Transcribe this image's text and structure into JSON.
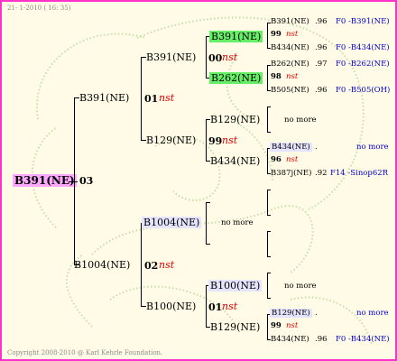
{
  "header": {
    "date": "21- 1-2010 ( 16: 35)"
  },
  "footer": {
    "copyright": "Copyright 2008-2010 @ Karl Kehrle Foundation."
  },
  "root": {
    "name": "B391(NE)",
    "code": "03"
  },
  "gen1": [
    {
      "name": "B391(NE)",
      "code": "01",
      "nst": "nst"
    },
    {
      "name": "B1004(NE)",
      "code": "02",
      "nst": "nst"
    }
  ],
  "gen2": [
    {
      "name": "B391(NE)",
      "code": "00",
      "nst": "nst"
    },
    {
      "name": "B129(NE)",
      "code": "99",
      "nst": "nst"
    },
    {
      "name": "B1004(NE)",
      "nomore": "no more"
    },
    {
      "name": "B100(NE)",
      "code": "01",
      "nst": "nst"
    }
  ],
  "gen3": [
    {
      "name": "B391(NE)"
    },
    {
      "name": "B262(NE)"
    },
    {
      "name": "B129(NE)"
    },
    {
      "name": "B434(NE)"
    },
    {
      "name": "B100(NE)"
    },
    {
      "name": "B129(NE)"
    }
  ],
  "gen3_nomore": [
    "no more",
    "no more",
    "no more"
  ],
  "gen4": [
    {
      "name": "B391(NE)",
      "val": ".96",
      "ref": "F0 -B391(NE)"
    },
    {
      "code": "99",
      "nst": "nst"
    },
    {
      "name": "B434(NE)",
      "val": ".96",
      "ref": "F0 -B434(NE)"
    },
    {
      "name": "B262(NE)",
      "val": ".97",
      "ref": "F0 -B262(NE)"
    },
    {
      "code": "98",
      "nst": "nst"
    },
    {
      "name": "B505(NE)",
      "val": ".96",
      "ref": "F0 -B505(OH)"
    },
    {
      "name": "B434(NE)",
      "val": ".",
      "ref": "no more"
    },
    {
      "code": "96",
      "nst": "nst"
    },
    {
      "name": "B387j(NE)",
      "val": ".92",
      "ref": "F14 -Sinop62R"
    },
    {
      "name": "B129(NE)",
      "val": ".",
      "ref": "no more"
    },
    {
      "code": "99",
      "nst": "nst"
    },
    {
      "name": "B434(NE)",
      "val": ".96",
      "ref": "F0 -B434(NE)"
    }
  ],
  "colors": {
    "frame": "#ff33cc",
    "root_bg": "#ffa8ff",
    "green_bg": "#66ee66",
    "purple_bg": "#e4e4ff",
    "nst": "#e00000",
    "ref": "#0000cc"
  }
}
